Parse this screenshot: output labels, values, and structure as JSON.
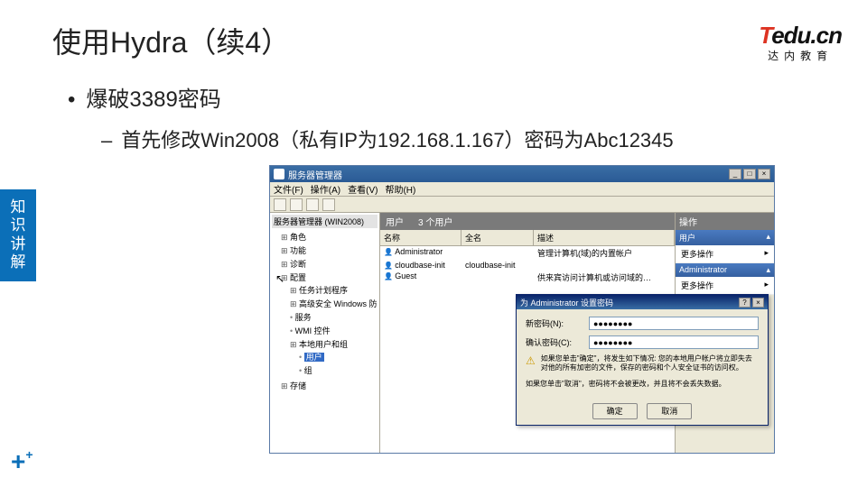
{
  "slide": {
    "title": "使用Hydra（续4）",
    "bullet1": "爆破3389密码",
    "bullet2": "首先修改Win2008（私有IP为192.168.1.167）密码为Abc12345",
    "side_tab": "知识讲解"
  },
  "logo": {
    "t": "T",
    "rest": "edu.cn",
    "sub": "达内教育"
  },
  "window": {
    "title": "服务器管理器",
    "menu": {
      "file": "文件(F)",
      "action": "操作(A)",
      "view": "查看(V)",
      "help": "帮助(H)"
    },
    "tree": {
      "header": "服务器管理器 (WIN2008)",
      "roles": "角色",
      "features": "功能",
      "diag": "诊断",
      "config": "配置",
      "task": "任务计划程序",
      "firewall": "高级安全 Windows 防",
      "services": "服务",
      "wmi": "WMI 控件",
      "local_users": "本地用户和组",
      "users": "用户",
      "groups": "组",
      "storage": "存储"
    },
    "center": {
      "header_title": "用户",
      "header_count": "3 个用户",
      "col_name": "名称",
      "col_fullname": "全名",
      "col_desc": "描述",
      "rows": [
        {
          "name": "Administrator",
          "full": "",
          "desc": "管理计算机(域)的内置帐户"
        },
        {
          "name": "cloudbase-init",
          "full": "cloudbase-init",
          "desc": ""
        },
        {
          "name": "Guest",
          "full": "",
          "desc": "供来宾访问计算机或访问域的…"
        }
      ]
    },
    "right": {
      "header": "操作",
      "sec_users": "用户",
      "more1": "更多操作",
      "sec_admin": "Administrator",
      "more2": "更多操作"
    }
  },
  "dialog": {
    "title": "为 Administrator 设置密码",
    "new_pwd_label": "新密码(N):",
    "confirm_label": "确认密码(C):",
    "pwd_value": "●●●●●●●●",
    "warn": "如果您单击\"确定\"，将发生如下情况:\n您的本地用户帐户将立即失去对他的所有加密的文件，保存的密码和个人安全证书的访问权。",
    "note": "如果您单击\"取消\"，密码将不会被更改，并且将不会丢失数据。",
    "ok": "确定",
    "cancel": "取消"
  }
}
